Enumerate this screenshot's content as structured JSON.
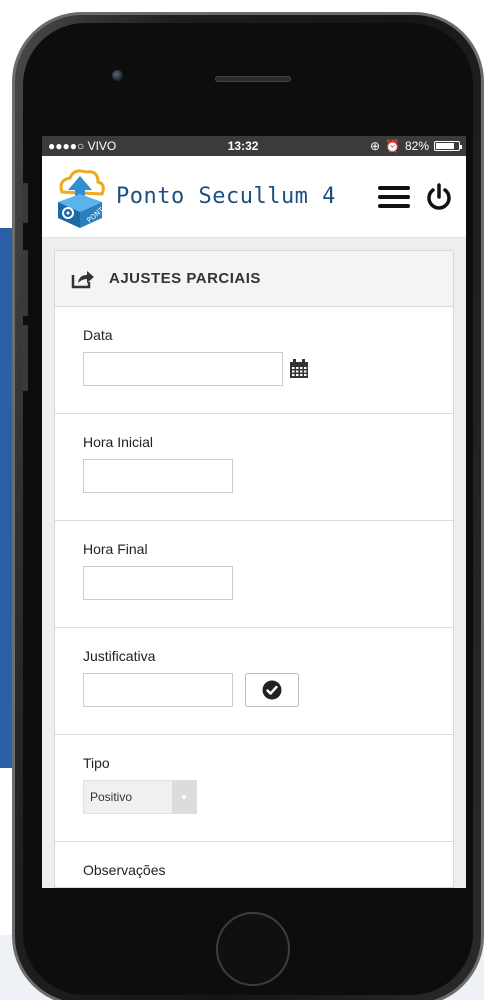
{
  "statusbar": {
    "carrier": "●●●●○ VIVO",
    "time": "13:32",
    "battery_text": "82%",
    "battery_level": 0.82
  },
  "header": {
    "app_title": "Ponto Secullum 4",
    "logo_text": "PONTO 4"
  },
  "panel": {
    "title": "AJUSTES PARCIAIS"
  },
  "form": {
    "data_label": "Data",
    "data_value": "",
    "hora_inicial_label": "Hora Inicial",
    "hora_inicial_value": "",
    "hora_final_label": "Hora Final",
    "hora_final_value": "",
    "justificativa_label": "Justificativa",
    "justificativa_value": "",
    "tipo_label": "Tipo",
    "tipo_selected": "Positivo",
    "observacoes_label": "Observações"
  },
  "colors": {
    "title_blue": "#1d4f80",
    "statusbar_bg": "#3b3b3b",
    "panel_heading_bg": "#f4f4f4",
    "side_panel_blue": "#2a5fa8"
  },
  "icons": {
    "menu": "hamburger-menu-icon",
    "power": "power-icon",
    "share": "share-icon",
    "calendar": "calendar-icon",
    "check": "check-circle-icon"
  }
}
